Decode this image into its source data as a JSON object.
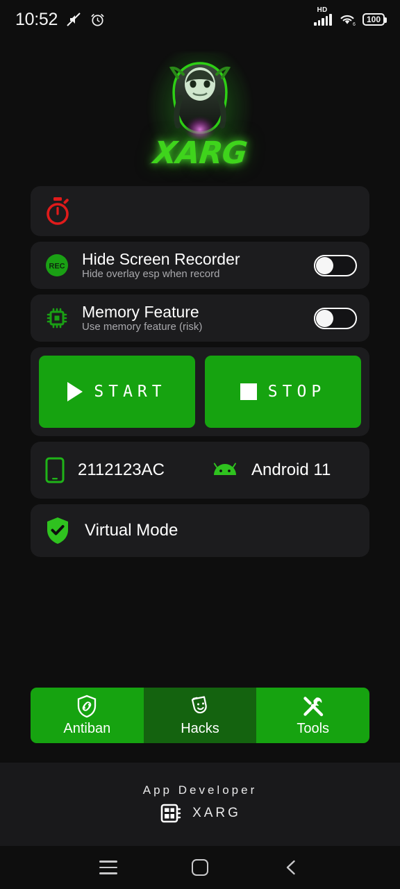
{
  "statusbar": {
    "time": "10:52",
    "icons_left": [
      "mute-icon",
      "alarm-icon"
    ],
    "network_label": "HD",
    "wifi": "wifi-6-icon",
    "battery_level": "100"
  },
  "logo": {
    "wordmark": "XARG",
    "alt": "xarg-mascot-logo",
    "glow_color": "#3fd41c"
  },
  "timer_card": {
    "icon": "stopwatch-icon",
    "icon_color": "#e01b1b",
    "value": ""
  },
  "toggles": [
    {
      "icon": "rec-icon",
      "icon_color": "#1aa014",
      "title": "Hide Screen Recorder",
      "subtitle": "Hide overlay esp when record",
      "state": "off"
    },
    {
      "icon": "memory-chip-icon",
      "icon_color": "#1aa014",
      "title": "Memory Feature",
      "subtitle": "Use memory feature (risk)",
      "state": "off"
    }
  ],
  "actions": {
    "start_label": "START",
    "start_icon": "play-icon",
    "stop_label": "STOP",
    "stop_icon": "stop-square-icon",
    "color": "#16a310"
  },
  "device": {
    "phone_icon": "smartphone-icon",
    "model": "2112123AC",
    "android_icon": "android-robot-icon",
    "os": "Android 11"
  },
  "virtual_mode": {
    "icon": "shield-check-icon",
    "label": "Virtual Mode"
  },
  "navtabs": [
    {
      "icon": "shield-link-icon",
      "label": "Antiban",
      "active": false
    },
    {
      "icon": "theater-masks-icon",
      "label": "Hacks",
      "active": true
    },
    {
      "icon": "tools-icon",
      "label": "Tools",
      "active": false
    }
  ],
  "footer": {
    "title": "App Developer",
    "icon": "memory-module-icon",
    "name": "XARG"
  },
  "sysnav": {
    "recents": "menu-icon",
    "home": "home-square-icon",
    "back": "back-chevron-icon"
  }
}
